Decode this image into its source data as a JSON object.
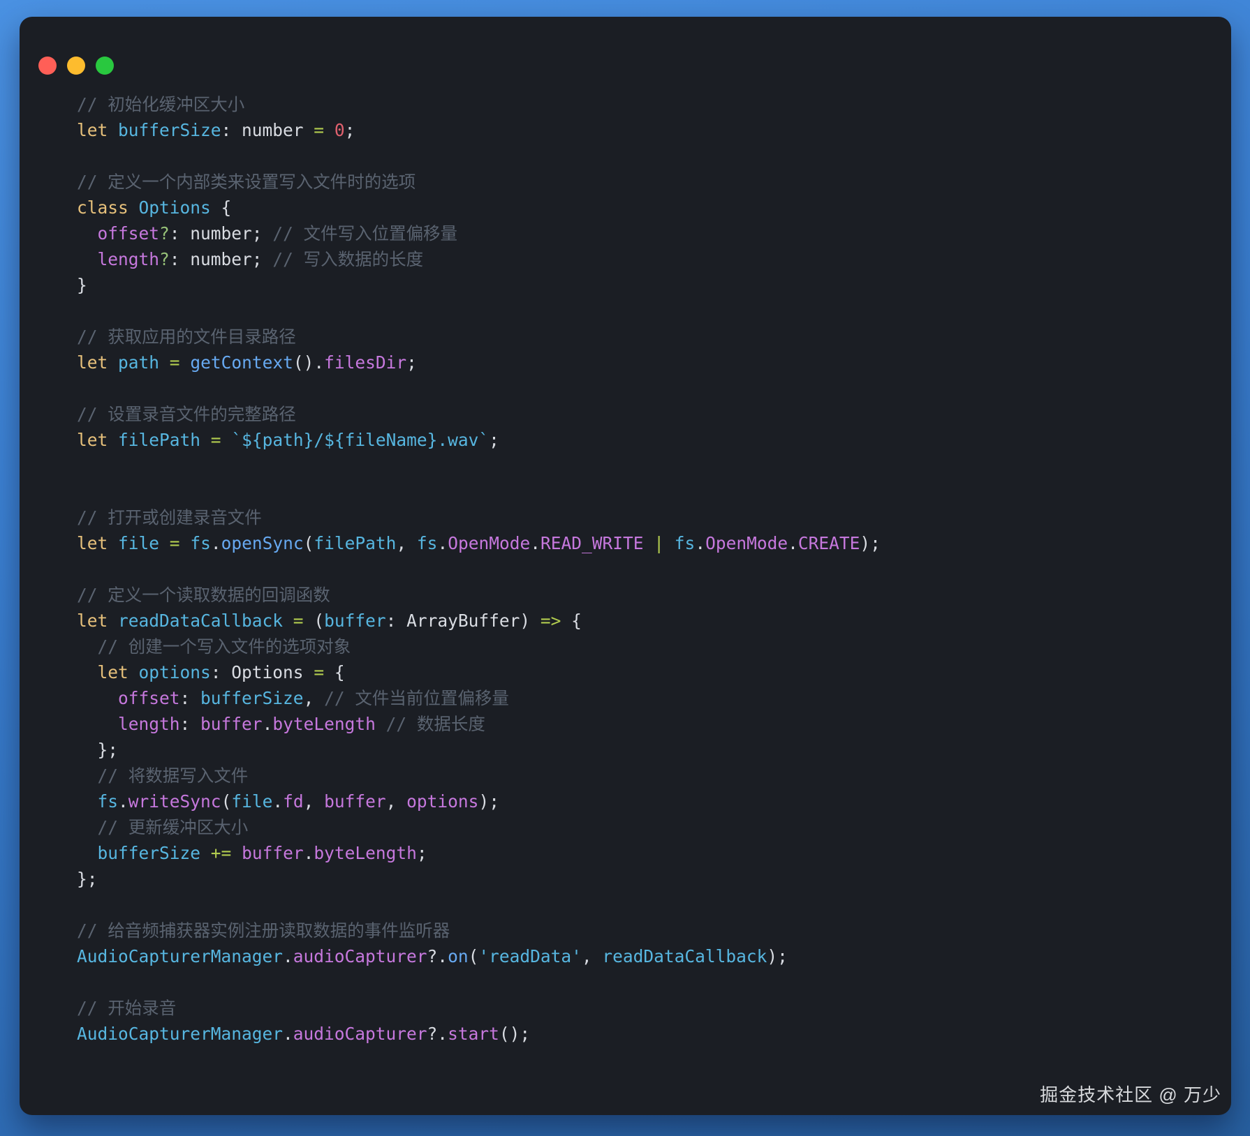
{
  "window": {
    "watermark": "掘金技术社区 @ 万少",
    "traffic_lights": [
      {
        "name": "close",
        "color": "#ff5f57"
      },
      {
        "name": "minimize",
        "color": "#fdbc2e"
      },
      {
        "name": "zoom",
        "color": "#29c83f"
      }
    ]
  },
  "colors": {
    "plain": "#d9dce2",
    "comment": "#5a6370",
    "kw": "#e6c07b",
    "cyan": "#57b6e0",
    "blue": "#67a9f1",
    "purple": "#c678dd",
    "lime": "#b2cc4f",
    "green": "#98c379",
    "red": "#e0616e"
  },
  "code": {
    "language": "arkts",
    "lines": [
      [
        {
          "t": "// 初始化缓冲区大小",
          "c": "comment"
        }
      ],
      [
        {
          "t": "let ",
          "c": "kw"
        },
        {
          "t": "bufferSize",
          "c": "cyan"
        },
        {
          "t": ": number ",
          "c": "plain"
        },
        {
          "t": "=",
          "c": "lime"
        },
        {
          "t": " ",
          "c": "plain"
        },
        {
          "t": "0",
          "c": "red"
        },
        {
          "t": ";",
          "c": "plain"
        }
      ],
      [],
      [
        {
          "t": "// 定义一个内部类来设置写入文件时的选项",
          "c": "comment"
        }
      ],
      [
        {
          "t": "class ",
          "c": "kw"
        },
        {
          "t": "Options",
          "c": "cyan"
        },
        {
          "t": " {",
          "c": "plain"
        }
      ],
      [
        {
          "t": "  ",
          "c": "plain"
        },
        {
          "t": "offset",
          "c": "purple"
        },
        {
          "t": "?",
          "c": "green"
        },
        {
          "t": ": number; ",
          "c": "plain"
        },
        {
          "t": "// 文件写入位置偏移量",
          "c": "comment"
        }
      ],
      [
        {
          "t": "  ",
          "c": "plain"
        },
        {
          "t": "length",
          "c": "purple"
        },
        {
          "t": "?",
          "c": "green"
        },
        {
          "t": ": number; ",
          "c": "plain"
        },
        {
          "t": "// 写入数据的长度",
          "c": "comment"
        }
      ],
      [
        {
          "t": "}",
          "c": "plain"
        }
      ],
      [],
      [
        {
          "t": "// 获取应用的文件目录路径",
          "c": "comment"
        }
      ],
      [
        {
          "t": "let ",
          "c": "kw"
        },
        {
          "t": "path",
          "c": "cyan"
        },
        {
          "t": " ",
          "c": "plain"
        },
        {
          "t": "=",
          "c": "lime"
        },
        {
          "t": " ",
          "c": "plain"
        },
        {
          "t": "getContext",
          "c": "blue"
        },
        {
          "t": "().",
          "c": "plain"
        },
        {
          "t": "filesDir",
          "c": "purple"
        },
        {
          "t": ";",
          "c": "plain"
        }
      ],
      [],
      [
        {
          "t": "// 设置录音文件的完整路径",
          "c": "comment"
        }
      ],
      [
        {
          "t": "let ",
          "c": "kw"
        },
        {
          "t": "filePath",
          "c": "cyan"
        },
        {
          "t": " ",
          "c": "plain"
        },
        {
          "t": "=",
          "c": "lime"
        },
        {
          "t": " ",
          "c": "plain"
        },
        {
          "t": "`${path}/${fileName}.wav`",
          "c": "cyan"
        },
        {
          "t": ";",
          "c": "plain"
        }
      ],
      [],
      [],
      [
        {
          "t": "// 打开或创建录音文件",
          "c": "comment"
        }
      ],
      [
        {
          "t": "let ",
          "c": "kw"
        },
        {
          "t": "file",
          "c": "cyan"
        },
        {
          "t": " ",
          "c": "plain"
        },
        {
          "t": "=",
          "c": "lime"
        },
        {
          "t": " ",
          "c": "plain"
        },
        {
          "t": "fs",
          "c": "cyan"
        },
        {
          "t": ".",
          "c": "plain"
        },
        {
          "t": "openSync",
          "c": "blue"
        },
        {
          "t": "(",
          "c": "plain"
        },
        {
          "t": "filePath",
          "c": "cyan"
        },
        {
          "t": ", ",
          "c": "plain"
        },
        {
          "t": "fs",
          "c": "cyan"
        },
        {
          "t": ".",
          "c": "plain"
        },
        {
          "t": "OpenMode",
          "c": "purple"
        },
        {
          "t": ".",
          "c": "plain"
        },
        {
          "t": "READ_WRITE",
          "c": "purple"
        },
        {
          "t": " ",
          "c": "plain"
        },
        {
          "t": "|",
          "c": "lime"
        },
        {
          "t": " ",
          "c": "plain"
        },
        {
          "t": "fs",
          "c": "cyan"
        },
        {
          "t": ".",
          "c": "plain"
        },
        {
          "t": "OpenMode",
          "c": "purple"
        },
        {
          "t": ".",
          "c": "plain"
        },
        {
          "t": "CREATE",
          "c": "purple"
        },
        {
          "t": ");",
          "c": "plain"
        }
      ],
      [],
      [
        {
          "t": "// 定义一个读取数据的回调函数",
          "c": "comment"
        }
      ],
      [
        {
          "t": "let ",
          "c": "kw"
        },
        {
          "t": "readDataCallback",
          "c": "cyan"
        },
        {
          "t": " ",
          "c": "plain"
        },
        {
          "t": "=",
          "c": "lime"
        },
        {
          "t": " (",
          "c": "plain"
        },
        {
          "t": "buffer",
          "c": "cyan"
        },
        {
          "t": ": ArrayBuffer) ",
          "c": "plain"
        },
        {
          "t": "=>",
          "c": "lime"
        },
        {
          "t": " {",
          "c": "plain"
        }
      ],
      [
        {
          "t": "  ",
          "c": "plain"
        },
        {
          "t": "// 创建一个写入文件的选项对象",
          "c": "comment"
        }
      ],
      [
        {
          "t": "  ",
          "c": "plain"
        },
        {
          "t": "let ",
          "c": "kw"
        },
        {
          "t": "options",
          "c": "cyan"
        },
        {
          "t": ": Options ",
          "c": "plain"
        },
        {
          "t": "=",
          "c": "lime"
        },
        {
          "t": " {",
          "c": "plain"
        }
      ],
      [
        {
          "t": "    ",
          "c": "plain"
        },
        {
          "t": "offset",
          "c": "purple"
        },
        {
          "t": ": ",
          "c": "plain"
        },
        {
          "t": "bufferSize",
          "c": "cyan"
        },
        {
          "t": ", ",
          "c": "plain"
        },
        {
          "t": "// 文件当前位置偏移量",
          "c": "comment"
        }
      ],
      [
        {
          "t": "    ",
          "c": "plain"
        },
        {
          "t": "length",
          "c": "purple"
        },
        {
          "t": ": ",
          "c": "plain"
        },
        {
          "t": "buffer",
          "c": "purple"
        },
        {
          "t": ".",
          "c": "plain"
        },
        {
          "t": "byteLength",
          "c": "purple"
        },
        {
          "t": " ",
          "c": "plain"
        },
        {
          "t": "// 数据长度",
          "c": "comment"
        }
      ],
      [
        {
          "t": "  };",
          "c": "plain"
        }
      ],
      [
        {
          "t": "  ",
          "c": "plain"
        },
        {
          "t": "// 将数据写入文件",
          "c": "comment"
        }
      ],
      [
        {
          "t": "  ",
          "c": "plain"
        },
        {
          "t": "fs",
          "c": "cyan"
        },
        {
          "t": ".",
          "c": "plain"
        },
        {
          "t": "writeSync",
          "c": "purple"
        },
        {
          "t": "(",
          "c": "plain"
        },
        {
          "t": "file",
          "c": "cyan"
        },
        {
          "t": ".",
          "c": "plain"
        },
        {
          "t": "fd",
          "c": "purple"
        },
        {
          "t": ", ",
          "c": "plain"
        },
        {
          "t": "buffer",
          "c": "purple"
        },
        {
          "t": ", ",
          "c": "plain"
        },
        {
          "t": "options",
          "c": "purple"
        },
        {
          "t": ");",
          "c": "plain"
        }
      ],
      [
        {
          "t": "  ",
          "c": "plain"
        },
        {
          "t": "// 更新缓冲区大小",
          "c": "comment"
        }
      ],
      [
        {
          "t": "  ",
          "c": "plain"
        },
        {
          "t": "bufferSize",
          "c": "cyan"
        },
        {
          "t": " ",
          "c": "plain"
        },
        {
          "t": "+=",
          "c": "lime"
        },
        {
          "t": " ",
          "c": "plain"
        },
        {
          "t": "buffer",
          "c": "purple"
        },
        {
          "t": ".",
          "c": "plain"
        },
        {
          "t": "byteLength",
          "c": "purple"
        },
        {
          "t": ";",
          "c": "plain"
        }
      ],
      [
        {
          "t": "};",
          "c": "plain"
        }
      ],
      [],
      [
        {
          "t": "// 给音频捕获器实例注册读取数据的事件监听器",
          "c": "comment"
        }
      ],
      [
        {
          "t": "AudioCapturerManager",
          "c": "cyan"
        },
        {
          "t": ".",
          "c": "plain"
        },
        {
          "t": "audioCapturer",
          "c": "purple"
        },
        {
          "t": "?.",
          "c": "plain"
        },
        {
          "t": "on",
          "c": "blue"
        },
        {
          "t": "(",
          "c": "plain"
        },
        {
          "t": "'readData'",
          "c": "cyan"
        },
        {
          "t": ", ",
          "c": "plain"
        },
        {
          "t": "readDataCallback",
          "c": "cyan"
        },
        {
          "t": ");",
          "c": "plain"
        }
      ],
      [],
      [
        {
          "t": "// 开始录音",
          "c": "comment"
        }
      ],
      [
        {
          "t": "AudioCapturerManager",
          "c": "cyan"
        },
        {
          "t": ".",
          "c": "plain"
        },
        {
          "t": "audioCapturer",
          "c": "purple"
        },
        {
          "t": "?.",
          "c": "plain"
        },
        {
          "t": "start",
          "c": "purple"
        },
        {
          "t": "();",
          "c": "plain"
        }
      ]
    ]
  }
}
